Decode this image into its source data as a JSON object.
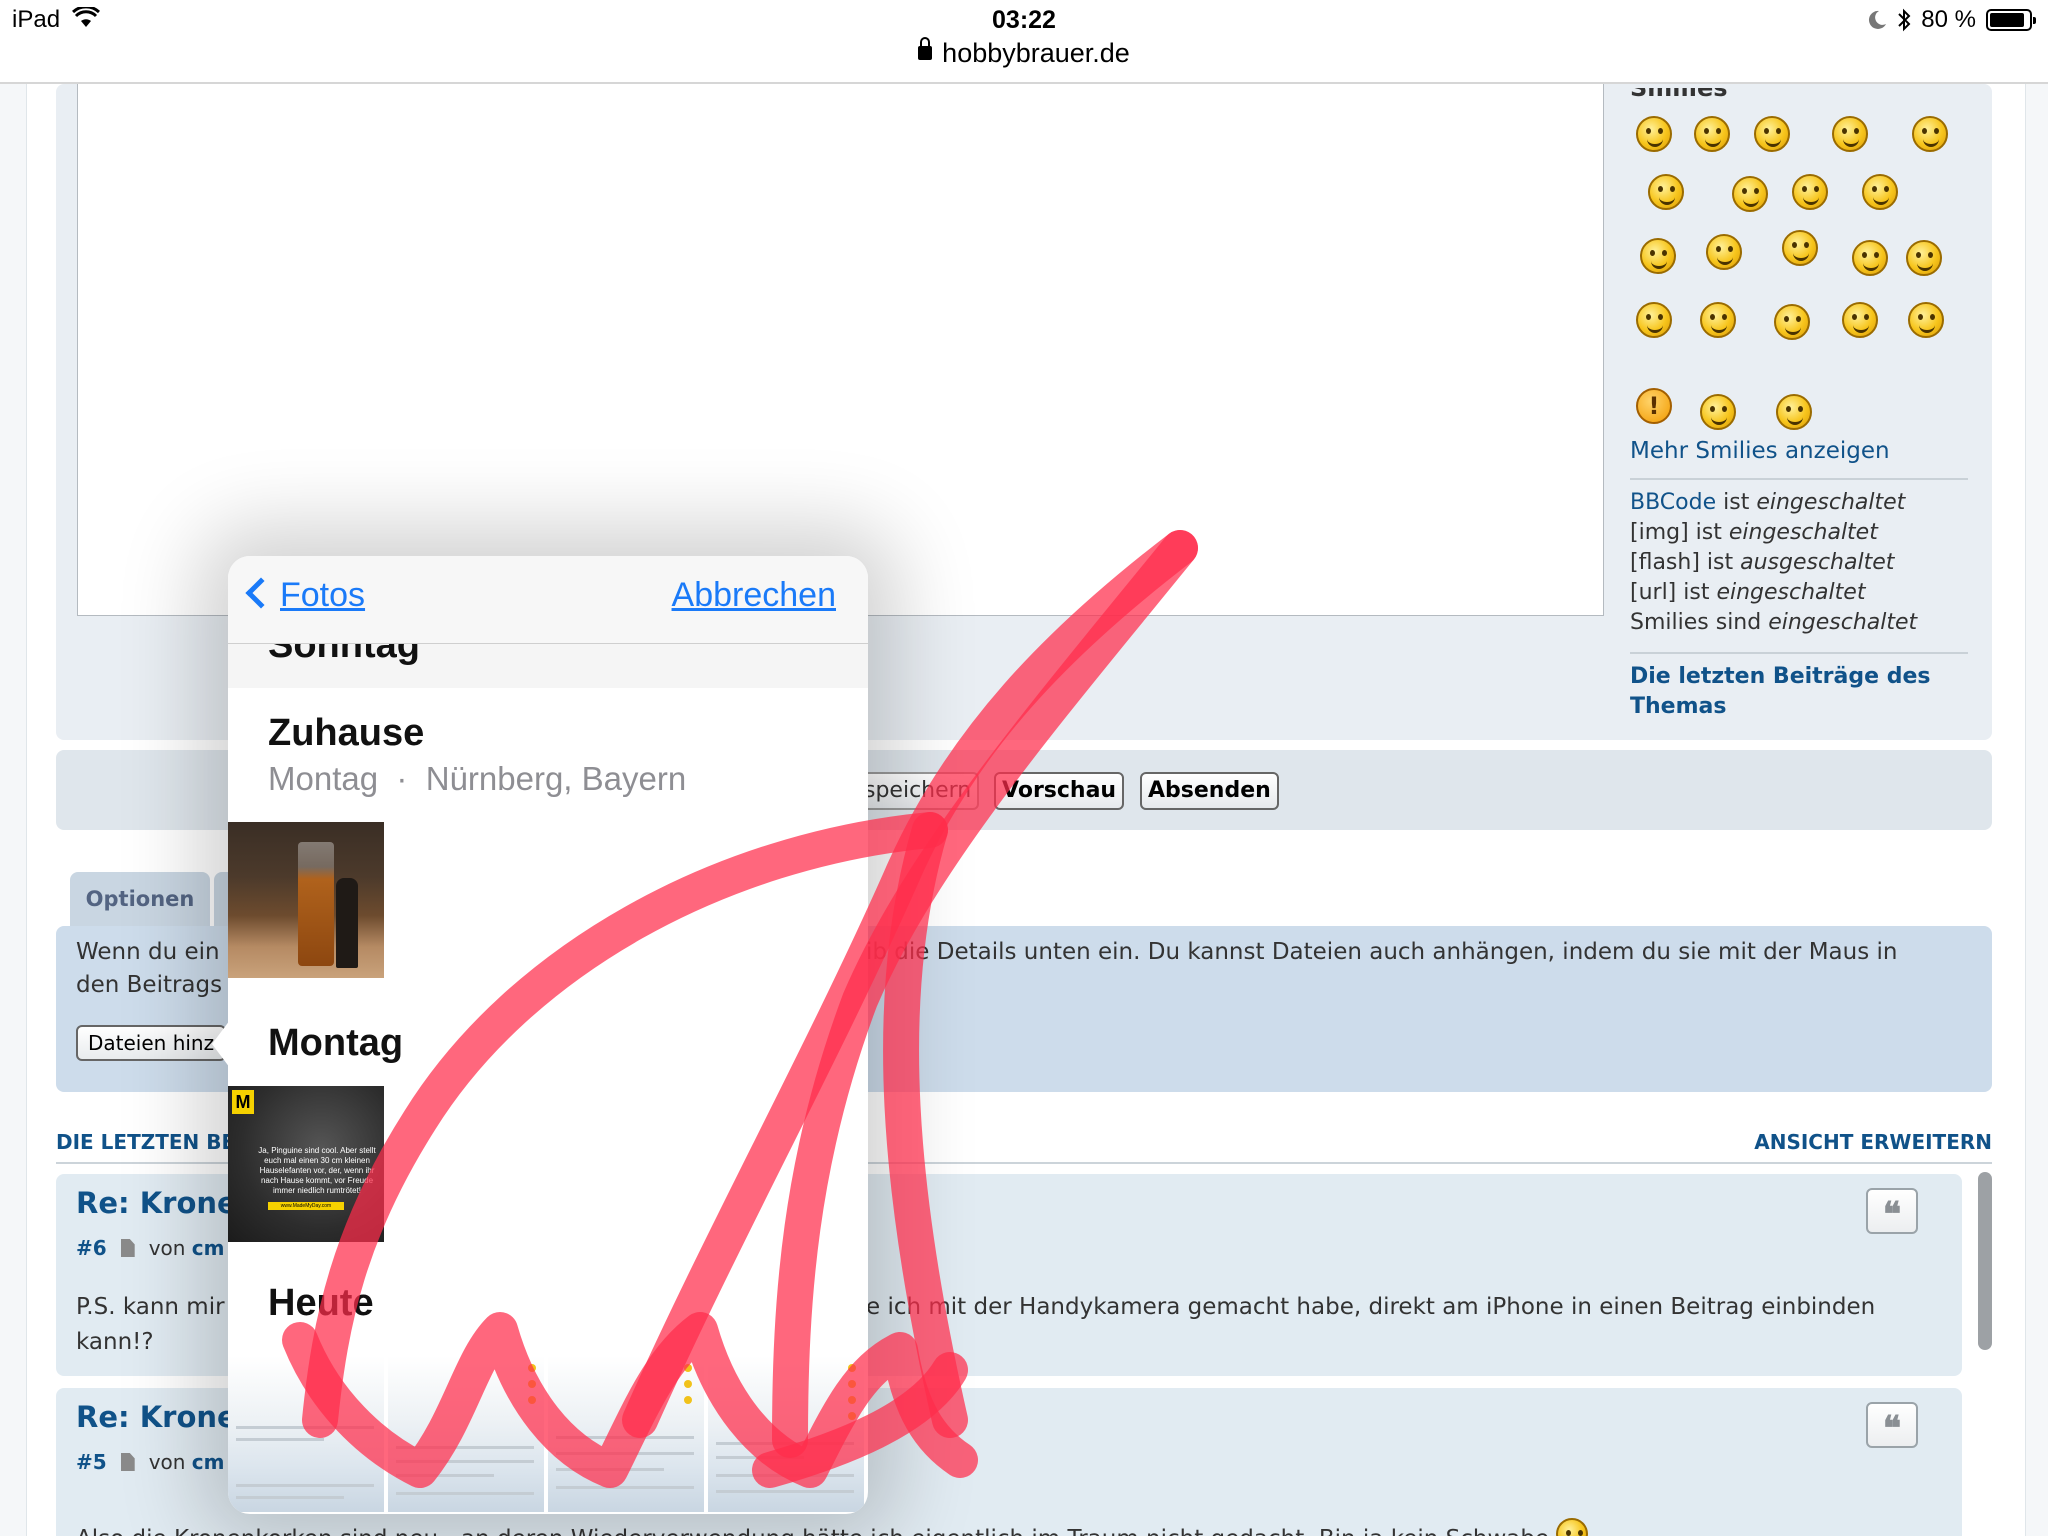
{
  "status_bar": {
    "device": "iPad",
    "time": "03:22",
    "url": "hobbybrauer.de",
    "battery": "80 %",
    "battery_level": 0.8
  },
  "smilies": {
    "title": "Smilies",
    "more_link": "Mehr Smilies anzeigen",
    "warn_glyph": "!"
  },
  "settings": [
    {
      "name": "BBCode",
      "mid": " ist ",
      "state": "eingeschaltet"
    },
    {
      "name": "[img]",
      "mid": " ist ",
      "state": "eingeschaltet"
    },
    {
      "name": "[flash]",
      "mid": " ist ",
      "state": "ausgeschaltet"
    },
    {
      "name": "[url]",
      "mid": " ist ",
      "state": "eingeschaltet"
    },
    {
      "name": "Smilies",
      "mid": " sind ",
      "state": "eingeschaltet"
    }
  ],
  "latest_posts_link": {
    "line1": "Die letzten Beiträge des",
    "line2": "Themas"
  },
  "buttons": {
    "save": "speichern",
    "preview": "Vorschau",
    "submit": "Absenden"
  },
  "options_tab": "Optionen",
  "attach": {
    "text_left_1": "Wenn du ein",
    "text_left_2": "den Beitrags",
    "text_right": "ib die Details unten ein. Du kannst Dateien auch anhängen, indem du sie mit der Maus in",
    "button": "Dateien hinz"
  },
  "recent": {
    "heading": "DIE LETZTEN BE",
    "expand": "ANSICHT ERWEITERN",
    "posts": [
      {
        "title": "Re: Kronen",
        "number": "#6",
        "by": "von",
        "author": "cm",
        "body_left_1": "P.S. kann mir",
        "body_right_1": "e ich mit der Handykamera gemacht habe, direkt am iPhone in einen Beitrag einbinden",
        "body_left_2": "kann!?"
      },
      {
        "title": "Re: Kronen",
        "number": "#5",
        "by": "von",
        "author": "cm",
        "body_1": "Also die Kronenkorken sind neu - an deren Wiederverwendung hätte ich eigentlich im Traum nicht gedacht. Bin ja kein Schwabe"
      }
    ],
    "quote_glyph": "❝"
  },
  "picker": {
    "back": "Fotos",
    "cancel": "Abbrechen",
    "sticky_header": "Sonntag",
    "moments": [
      {
        "title": "Zuhause",
        "subtitle": "Montag  ·  Nürnberg, Bayern"
      },
      {
        "title": "Montag"
      },
      {
        "title": "Heute"
      }
    ],
    "meme_badge": "M",
    "meme_caption": "Ja, Pinguine sind cool. Aber stellt euch mal einen 30 cm kleinen Hauselefanten vor, der, wenn ihr nach Hause kommt, vor Freude immer niedlich rumtrötet!",
    "meme_footer": "www.MadeMyDay.com"
  },
  "colors": {
    "link_blue": "#105289",
    "ios_blue": "#1a7af8",
    "panel": "#e9eef3",
    "annotation_red": "#ff2d4b"
  },
  "icons": {
    "wifi": "wifi-icon",
    "lock": "lock-icon",
    "moon": "moon-icon",
    "bluetooth": "bluetooth-icon",
    "battery": "battery-icon",
    "back_chevron": "chevron-left-icon",
    "document": "document-icon",
    "quote": "quote-icon"
  }
}
